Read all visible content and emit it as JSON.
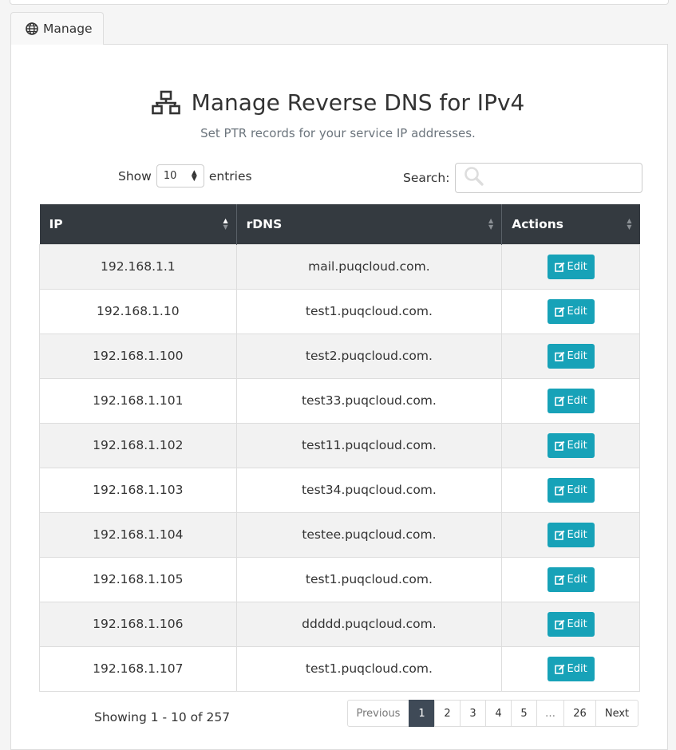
{
  "tab": {
    "label": "Manage",
    "icon": "globe-icon"
  },
  "header": {
    "title": "Manage Reverse DNS for IPv4",
    "title_icon": "network-icon",
    "subtitle": "Set PTR records for your service IP addresses."
  },
  "length": {
    "show_label": "Show",
    "value": "10",
    "entries_label": "entries"
  },
  "search": {
    "label": "Search:",
    "placeholder": "",
    "icon": "search-icon"
  },
  "table": {
    "columns": [
      "IP",
      "rDNS",
      "Actions"
    ],
    "edit_label": "Edit",
    "rows": [
      {
        "ip": "192.168.1.1",
        "rdns": "mail.puqcloud.com."
      },
      {
        "ip": "192.168.1.10",
        "rdns": "test1.puqcloud.com."
      },
      {
        "ip": "192.168.1.100",
        "rdns": "test2.puqcloud.com."
      },
      {
        "ip": "192.168.1.101",
        "rdns": "test33.puqcloud.com."
      },
      {
        "ip": "192.168.1.102",
        "rdns": "test11.puqcloud.com."
      },
      {
        "ip": "192.168.1.103",
        "rdns": "test34.puqcloud.com."
      },
      {
        "ip": "192.168.1.104",
        "rdns": "testee.puqcloud.com."
      },
      {
        "ip": "192.168.1.105",
        "rdns": "test1.puqcloud.com."
      },
      {
        "ip": "192.168.1.106",
        "rdns": "ddddd.puqcloud.com."
      },
      {
        "ip": "192.168.1.107",
        "rdns": "test1.puqcloud.com."
      }
    ]
  },
  "footer": {
    "info": "Showing 1 - 10 of 257",
    "pagination": [
      "Previous",
      "1",
      "2",
      "3",
      "4",
      "5",
      "…",
      "26",
      "Next"
    ],
    "active_page": "1"
  },
  "colors": {
    "header_bg": "#343a40",
    "edit_button": "#17a2b8",
    "active_page": "#3f4a57"
  }
}
